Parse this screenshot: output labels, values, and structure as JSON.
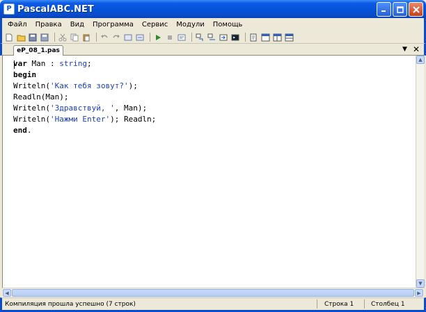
{
  "window": {
    "title": "PascalABC.NET",
    "app_icon_glyph": "P"
  },
  "menu": {
    "items": [
      "Файл",
      "Правка",
      "Вид",
      "Программа",
      "Сервис",
      "Модули",
      "Помощь"
    ]
  },
  "tabs": [
    {
      "label": "eP_08_1.pas"
    }
  ],
  "editor": {
    "lines": [
      {
        "parts": [
          {
            "t": "var",
            "c": "kw"
          },
          {
            "t": " Man : ",
            "c": ""
          },
          {
            "t": "string",
            "c": "type"
          },
          {
            "t": ";",
            "c": ""
          }
        ]
      },
      {
        "parts": [
          {
            "t": "begin",
            "c": "kw"
          }
        ]
      },
      {
        "parts": [
          {
            "t": "Writeln(",
            "c": ""
          },
          {
            "t": "'Как тебя зовут?'",
            "c": "str"
          },
          {
            "t": ");",
            "c": ""
          }
        ]
      },
      {
        "parts": [
          {
            "t": "Readln(Man);",
            "c": ""
          }
        ]
      },
      {
        "parts": [
          {
            "t": "Writeln(",
            "c": ""
          },
          {
            "t": "'Здравствуй, '",
            "c": "str"
          },
          {
            "t": ", Man);",
            "c": ""
          }
        ]
      },
      {
        "parts": [
          {
            "t": "Writeln(",
            "c": ""
          },
          {
            "t": "'Нажми Enter'",
            "c": "str"
          },
          {
            "t": "); Readln;",
            "c": ""
          }
        ]
      },
      {
        "parts": [
          {
            "t": "end",
            "c": "kw"
          },
          {
            "t": ".",
            "c": ""
          }
        ]
      }
    ]
  },
  "status": {
    "message": "Компиляция прошла успешно (7 строк)",
    "row": "Строка  1",
    "col": "Столбец  1"
  },
  "colors": {
    "titlebar": "#0553d8",
    "string_literal": "#1a3fc6",
    "keyword": "#000000"
  }
}
